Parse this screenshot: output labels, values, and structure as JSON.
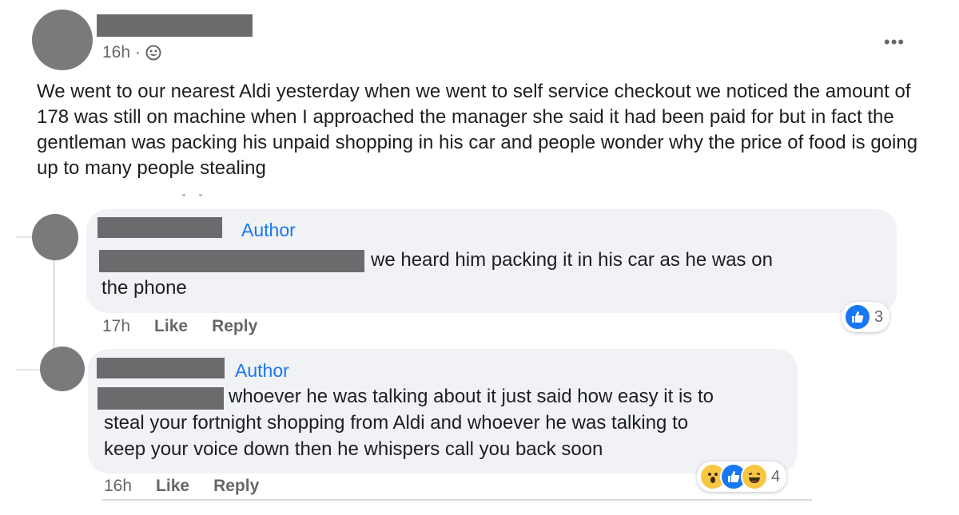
{
  "post": {
    "time": "16h ·",
    "privacy_icon": "friends-globe-icon",
    "more_label": "•••",
    "text": "We went to our nearest Aldi yesterday when we went to self service checkout we noticed the amount of 178 was still on machine when I approached the manager she said it had been paid for but in fact the gentleman was packing his unpaid shopping in his car and people wonder why the price of food is going up to many people stealing"
  },
  "comments": [
    {
      "badge": "Author",
      "text_line1": "we heard him packing it in his car as he was on",
      "text_line2": "the phone",
      "time": "17h",
      "like_label": "Like",
      "reply_label": "Reply",
      "reactions": {
        "icons": [
          "like-icon"
        ],
        "count": "3"
      }
    },
    {
      "badge": "Author",
      "text_line1": "whoever he was talking about it just said how easy it is to",
      "text_line2": "steal your fortnight shopping from Aldi and whoever he was talking to",
      "text_line3": "keep your voice down then he whispers call you back soon",
      "time": "16h",
      "like_label": "Like",
      "reply_label": "Reply",
      "reactions": {
        "icons": [
          "wow-icon",
          "like-icon",
          "haha-icon"
        ],
        "count": "4"
      }
    }
  ],
  "colors": {
    "accent": "#1877f2",
    "bubble": "#f0f2f5",
    "redaction": "#6b6b6e",
    "muted": "#65676b"
  }
}
